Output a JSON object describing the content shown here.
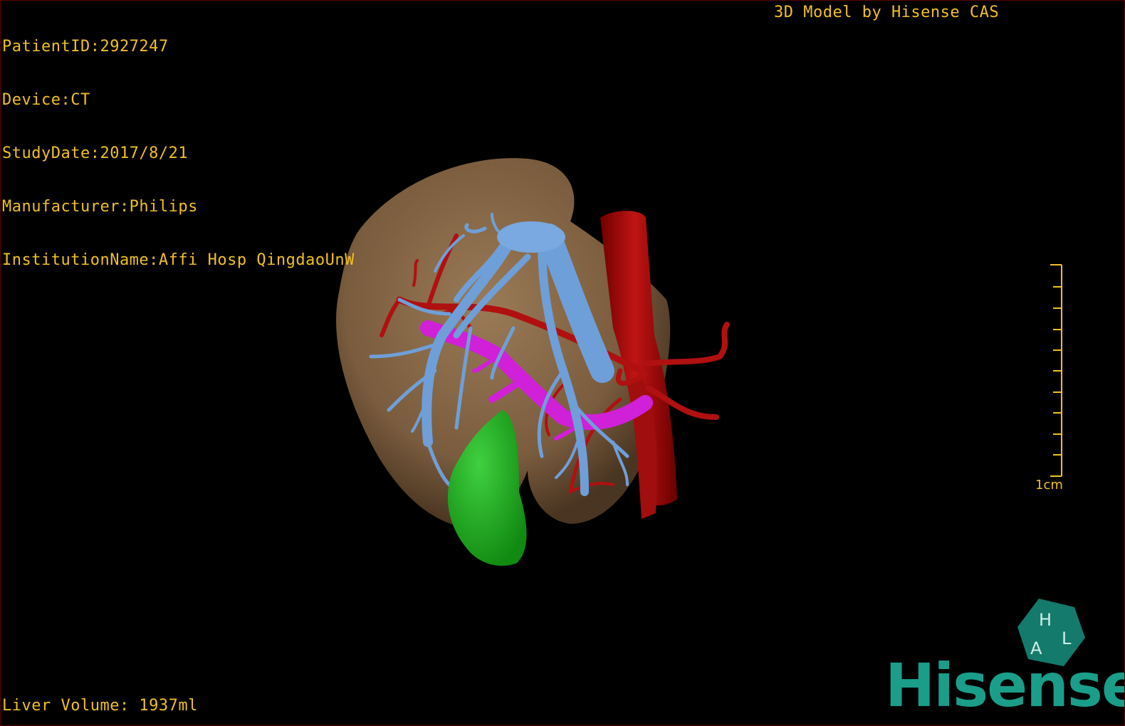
{
  "info": {
    "patient_id": "PatientID:2927247",
    "device": "Device:CT",
    "study_date": "StudyDate:2017/8/21",
    "manufacturer": "Manufacturer:Philips",
    "institution": "InstitutionName:Affi Hosp QingdaoUnW"
  },
  "credit": "3D Model by Hisense CAS",
  "volume": "Liver Volume: 1937ml",
  "scale": {
    "label": "1cm"
  },
  "logo": {
    "cube_letters": [
      "H",
      "A",
      "L"
    ],
    "brand": "Hisense"
  },
  "colors": {
    "overlay_text": "#f0c020",
    "liver": "#8a6a48",
    "hepatic_vein": "#6f9fd8",
    "portal_vein": "#d020d8",
    "artery": "#b01010",
    "gallbladder": "#20b020",
    "brand": "#1a9e8a"
  }
}
